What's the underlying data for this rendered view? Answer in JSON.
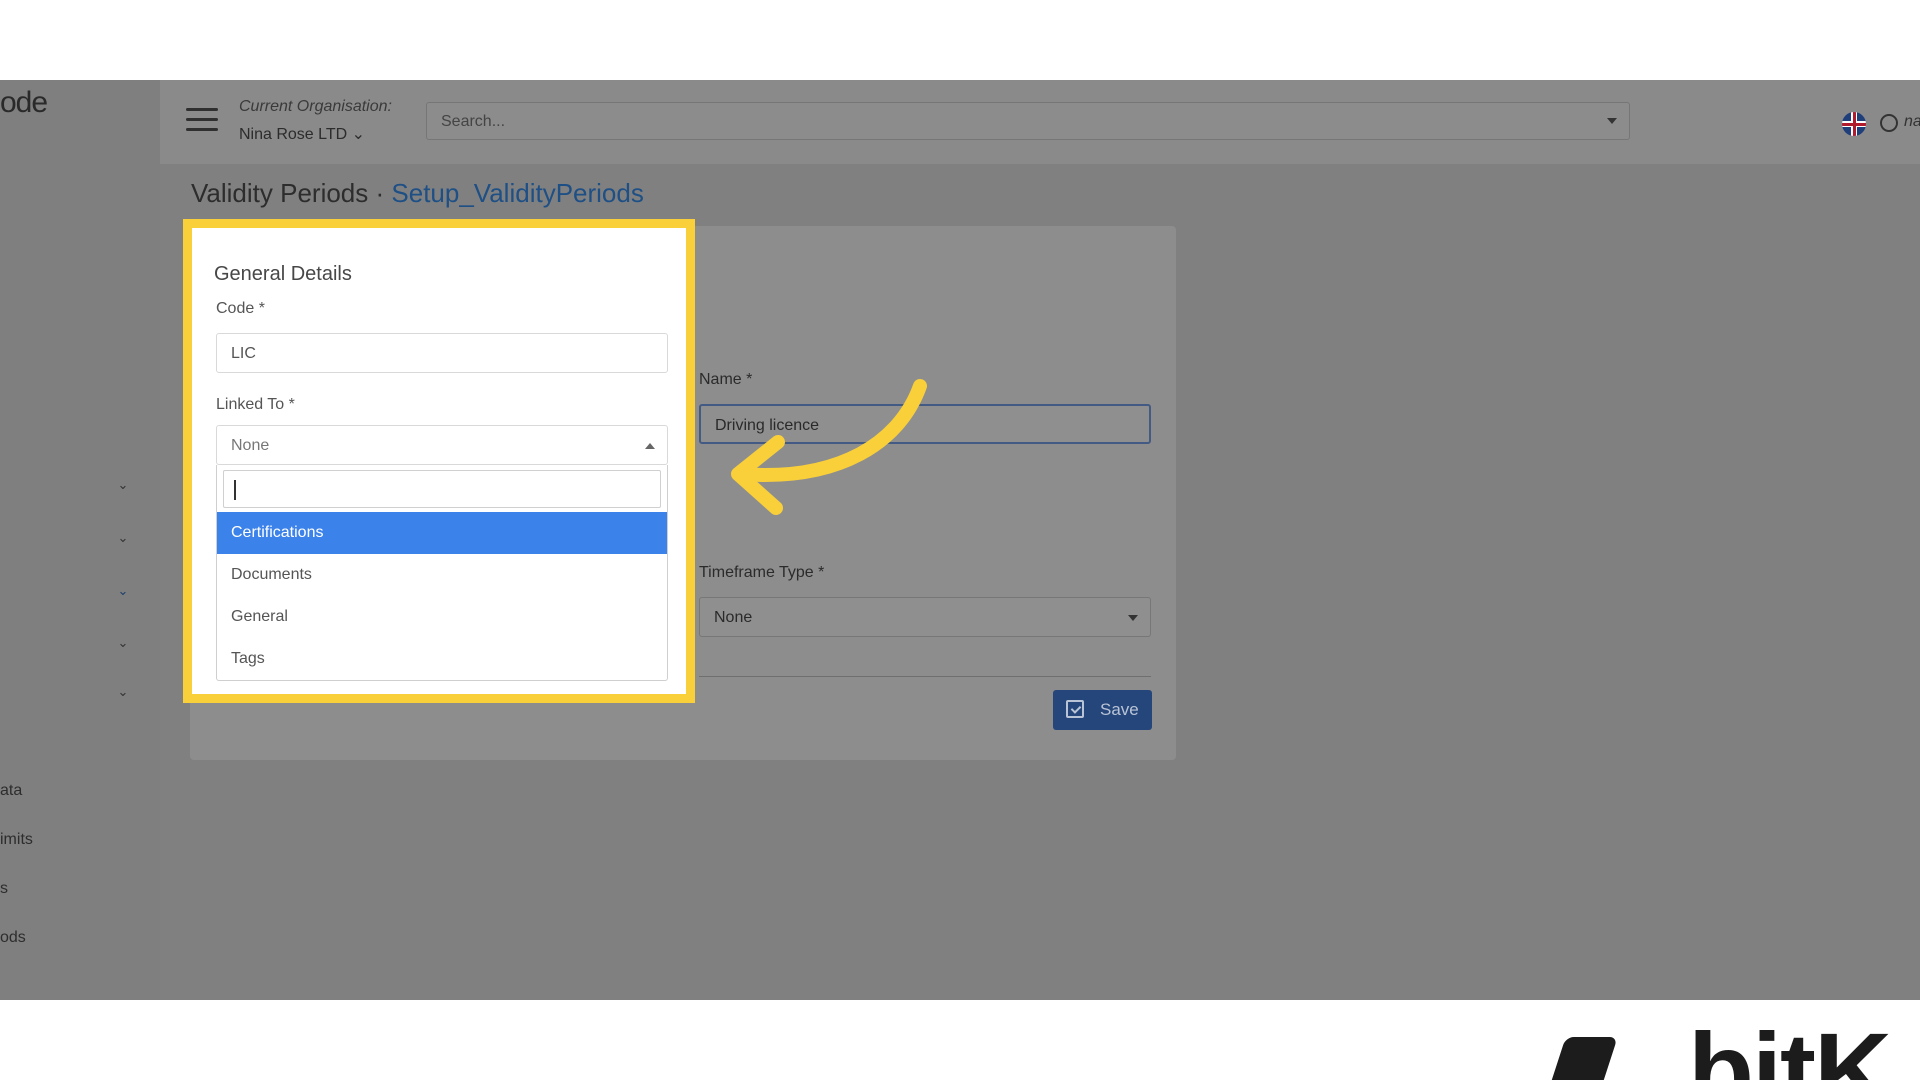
{
  "app": {
    "logo_text": "ode",
    "topbar": {
      "org_label": "Current Organisation:",
      "org_value": "Nina Rose LTD ⌄",
      "search_placeholder": "Search...",
      "user_name": "na"
    },
    "sidebar": {
      "items": [
        "ata",
        "imits",
        "s",
        "ods"
      ]
    },
    "page": {
      "title": "Validity Periods",
      "separator": "·",
      "subtitle": "Setup_ValidityPeriods"
    },
    "form": {
      "name_label": "Name *",
      "name_value": "Driving licence",
      "timeframe_label": "Timeframe Type *",
      "timeframe_value": "None",
      "save_label": "Save"
    }
  },
  "highlight": {
    "section_title": "General Details",
    "code_label": "Code *",
    "code_value": "LIC",
    "linked_label": "Linked To *",
    "linked_value": "None",
    "search_value": "",
    "options": [
      "Certifications",
      "Documents",
      "General",
      "Tags"
    ],
    "selected_index": 0
  },
  "colors": {
    "highlight_border": "#f9cf3a",
    "selected_option": "#3b82eb",
    "save_button": "#25467a",
    "link_accent": "#1e4f85"
  },
  "brand": {
    "text": "bitK"
  }
}
